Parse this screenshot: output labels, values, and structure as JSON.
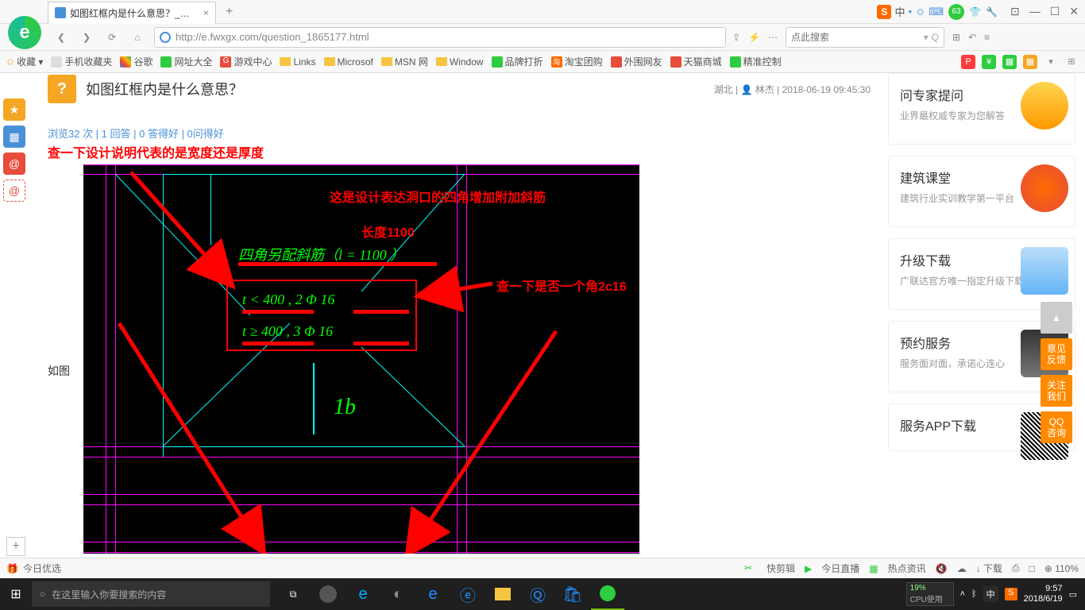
{
  "tab": {
    "title": "如图红框内是什么意思？_广联达",
    "close": "×"
  },
  "newtab": "+",
  "ime": {
    "s": "S",
    "lang": "中",
    "bullet": "•",
    "emoji": "☺"
  },
  "notif_count": "63",
  "win": {
    "min": "—",
    "max": "☐",
    "close": "✕",
    "pop": "⊡"
  },
  "nav": {
    "back": "❮",
    "fwd": "❯",
    "reload": "⟳",
    "home": "⌂"
  },
  "url": "http://e.fwxgx.com/question_1865177.html",
  "addr_icons": {
    "share": "⇪",
    "bolt": "⚡",
    "more": "⋯"
  },
  "search_placeholder": "点此搜索",
  "addr_right": {
    "search": "🔍",
    "ext": "⊞",
    "undo": "↶",
    "menu": "≡"
  },
  "bookmarks": {
    "fav": "✩ 收藏",
    "items": [
      "手机收藏夹",
      "谷歌",
      "网址大全",
      "游戏中心",
      "Links",
      "Microsof",
      "MSN 网",
      "Window",
      "品牌打折",
      "淘宝团购",
      "外围网友",
      "天猫商城",
      "精准控制"
    ]
  },
  "bookbar_right": [
    "P",
    "¥",
    "▦",
    "▦",
    "▾",
    "⊞"
  ],
  "left_float": [
    "★",
    "▦",
    "@",
    "@"
  ],
  "question": {
    "icon": "?",
    "title": "如图红框内是什么意思？",
    "region": "湖北",
    "user_label": "👤 林杰",
    "timestamp": "2018-06-19 09:45:30",
    "stats": "浏览32 次 | 1 回答 | 0 答得好 | 0问得好"
  },
  "red": {
    "note1": "查一下设计说明代表的是宽度还是厚度",
    "note2": "这是设计表达洞口的四角增加附加斜筋",
    "note3": "长度1100",
    "note4": "查一下是否一个角2c16",
    "side_label": "如图"
  },
  "cad": {
    "line1": "四角另配斜筋（l = 1100   ）",
    "line2": "t <   400    ,   2 Φ 16",
    "line3": "t ≥   400    ,   3 Φ 16",
    "mark": "1b"
  },
  "aside": {
    "card1": {
      "title": "问专家提问",
      "sub": "业界最权威专家为您解答"
    },
    "card2": {
      "title": "建筑课堂",
      "sub": "建筑行业实训教学第一平台"
    },
    "card3": {
      "title": "升级下载",
      "sub": "广联达官方唯一指定升级下载"
    },
    "card4": {
      "title": "预约服务",
      "sub": "服务面对面，承诺心连心"
    },
    "card5": {
      "title": "服务APP下载",
      "sub": ""
    }
  },
  "right_float": {
    "top": "▲",
    "b1": "意见\n反馈",
    "b2": "关注\n我们",
    "b3": "QQ\n咨询"
  },
  "statusbar": {
    "left": "今日优选",
    "items": [
      "快剪辑",
      "今日直播",
      "热点资讯",
      "☁",
      "↓ 下载",
      "⎙",
      "□",
      "⊕ 110%"
    ],
    "scissors": "✂"
  },
  "taskbar": {
    "start": "⊞",
    "search_placeholder": "在这里输入你要搜索的内容",
    "cortana": "○",
    "taskview": "⧉",
    "meter": {
      "pct": "19%",
      "label": "CPU使用"
    },
    "tray_up": "˄",
    "lang": "中",
    "s": "S",
    "time": "9:57",
    "date": "2018/6/19",
    "notif": "▭"
  }
}
